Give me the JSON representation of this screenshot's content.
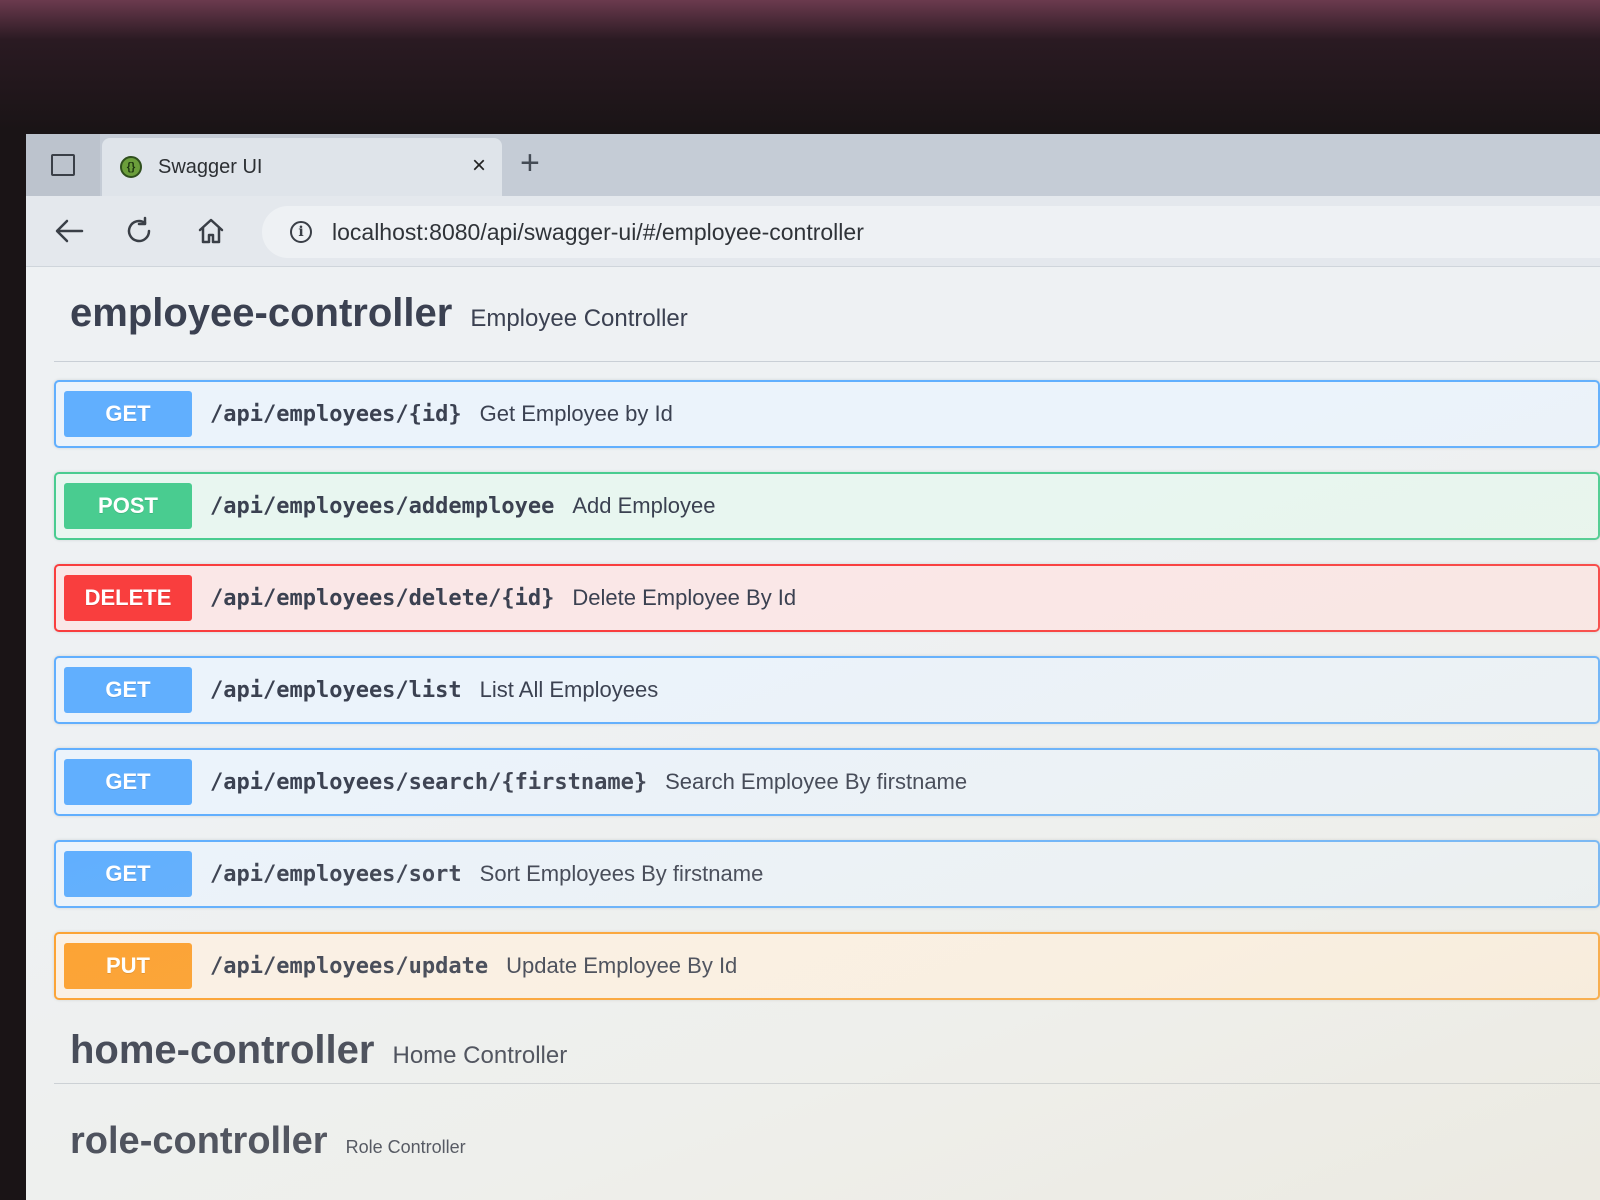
{
  "browser": {
    "tab_title": "Swagger UI",
    "tab_close": "×",
    "new_tab": "+",
    "url": "localhost:8080/api/swagger-ui/#/employee-controller",
    "icons": {
      "back": "back-arrow-icon",
      "reload": "reload-icon",
      "home": "home-icon",
      "info": "info-icon",
      "tab_actions": "tab-actions-icon",
      "favicon": "swagger-favicon-icon"
    }
  },
  "employee_controller": {
    "name": "employee-controller",
    "description": "Employee Controller",
    "operations": [
      {
        "method": "GET",
        "path": "/api/employees/{id}",
        "summary": "Get Employee by Id"
      },
      {
        "method": "POST",
        "path": "/api/employees/addemployee",
        "summary": "Add Employee"
      },
      {
        "method": "DELETE",
        "path": "/api/employees/delete/{id}",
        "summary": "Delete Employee By Id"
      },
      {
        "method": "GET",
        "path": "/api/employees/list",
        "summary": "List All Employees"
      },
      {
        "method": "GET",
        "path": "/api/employees/search/{firstname}",
        "summary": "Search Employee By firstname"
      },
      {
        "method": "GET",
        "path": "/api/employees/sort",
        "summary": "Sort Employees By firstname"
      },
      {
        "method": "PUT",
        "path": "/api/employees/update",
        "summary": "Update Employee By Id"
      }
    ]
  },
  "home_controller": {
    "name": "home-controller",
    "description": "Home Controller"
  },
  "role_controller": {
    "name": "role-controller",
    "description": "Role Controller"
  },
  "colors": {
    "get": "#61affe",
    "post": "#49cc90",
    "delete": "#f93e3e",
    "put": "#fca130",
    "text": "#3b4151"
  }
}
